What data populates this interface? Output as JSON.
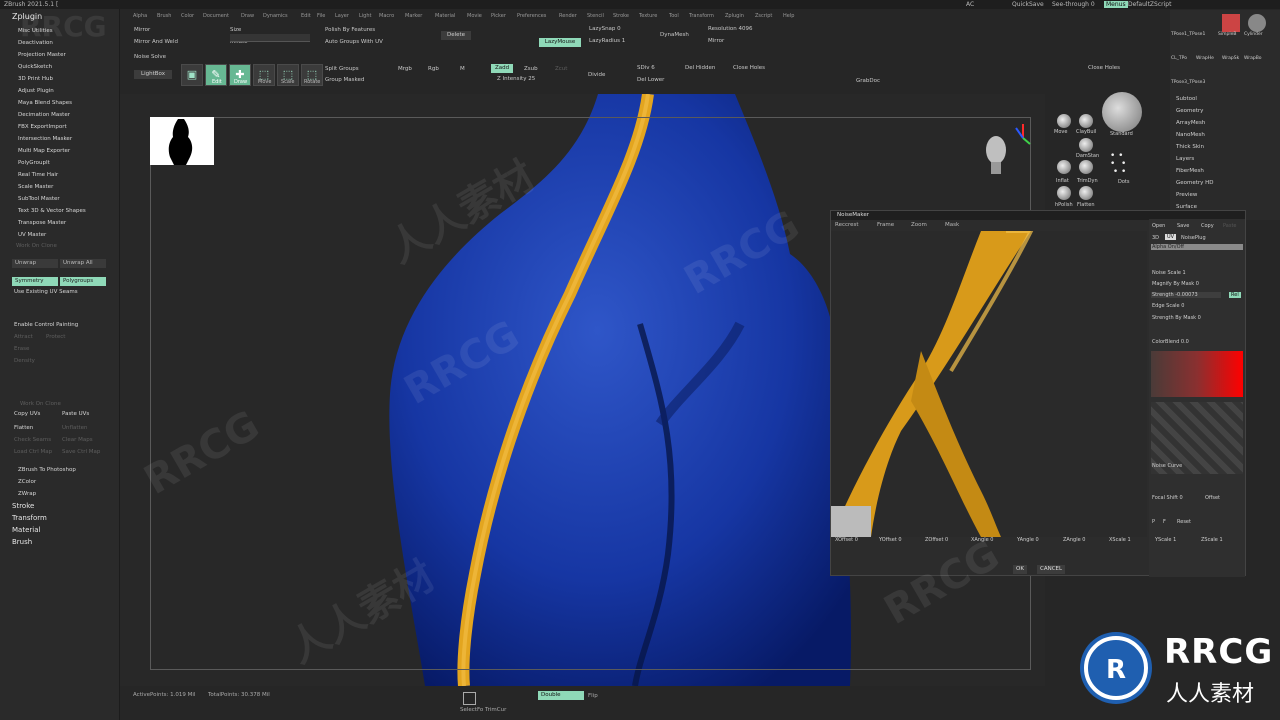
{
  "app": {
    "title": "ZBrush 2021.5.1 ["
  },
  "titlebar": {
    "ac": "AC",
    "quicksave": "QuickSave",
    "seethrough": "See-through 0",
    "menus": "Menus",
    "script": "DefaultZScript"
  },
  "menubar": [
    "Alpha",
    "Brush",
    "Color",
    "Document",
    "Draw",
    "Dynamics",
    "Edit",
    "File",
    "Layer",
    "Light",
    "Macro",
    "Marker",
    "Material",
    "Movie",
    "Picker",
    "Preferences",
    "Render",
    "Stencil",
    "Stroke",
    "Texture",
    "Tool",
    "Transform",
    "Zplugin",
    "Zscript",
    "Help"
  ],
  "left_panel": {
    "header": "Zplugin",
    "items": [
      "Misc Utilities",
      "Deactivation",
      "Projection Master",
      "QuickSketch",
      "3D Print Hub",
      "Adjust Plugin",
      "Maya Blend Shapes",
      "Decimation Master",
      "FBX ExportImport",
      "Intersection Masker",
      "Multi Map Exporter",
      "PolyGroupIt",
      "Real Time Hair",
      "Scale Master",
      "SubTool Master",
      "Text 3D & Vector Shapes",
      "Transpose Master",
      "UV Master"
    ],
    "uv": {
      "work_on_clone": "Work On Clone",
      "unwrap": "Unwrap",
      "unwrap_all": "Unwrap All",
      "symmetry": "Symmetry",
      "polygroups": "Polygroups",
      "use_existing": "Use Existing UV Seams",
      "enable_control": "Enable Control Painting",
      "copy_uvs": "Copy UVs",
      "paste_uvs": "Paste UVs",
      "flatten": "Flatten",
      "unflatten": "Unflatten",
      "check_seams": "Check Seams",
      "clear_maps": "Clear Maps",
      "load_ctrl": "Load Ctrl Map",
      "save_ctrl": "Save Ctrl Map",
      "attract": "Attract",
      "protect": "Protect",
      "erase": "Erase",
      "density": "Density",
      "work_clone2": "Work On Clone"
    },
    "extra": [
      "ZBrush To Photoshop",
      "ZColor",
      "ZWrap"
    ],
    "sections": [
      "Stroke",
      "Transform",
      "Material",
      "Brush"
    ]
  },
  "toolbar": {
    "mirror": "Mirror",
    "mirror_weld": "Mirror And Weld",
    "size": "Size",
    "inflate": "Inflate",
    "polish": "Polish By Features",
    "auto_groups": "Auto Groups With UV",
    "delete": "Delete",
    "lazysnap": "LazySnap 0",
    "lazymouse": "LazyMouse",
    "lazyradius": "LazyRadius 1",
    "dynamesh": "DynaMesh",
    "resolution": "Resolution 4096",
    "mirror2": "Mirror",
    "noise_solve": "Noise Solve",
    "lightbox": "LightBox",
    "edit": "Edit",
    "draw": "Draw",
    "move": "Move",
    "scale": "Scale",
    "rotate": "Rotate",
    "split_groups": "Split Groups",
    "group_masked": "Group Masked",
    "mrgb": "Mrgb",
    "rgb": "Rgb",
    "m": "M",
    "zadd": "Zadd",
    "zsub": "Zsub",
    "zcut": "Zcut",
    "z_intensity": "Z Intensity 25",
    "divide": "Divide",
    "sdiv": "SDiv 6",
    "del_lower": "Del Lower",
    "del_hidden": "Del Hidden",
    "close_holes": "Close Holes",
    "close_holes2": "Close Holes",
    "grabdoc": "GrabDoc"
  },
  "right_dock": [
    "Move",
    "ClayBuil",
    "Standard",
    "DamStan",
    "Inflat",
    "TrimDyn",
    "Dots",
    "hPolish",
    "Flatten"
  ],
  "right_panel": {
    "thumbs": [
      "TPose1_TPose1",
      "SimpleB",
      "Cylinder",
      "CL_TPo",
      "WrapHe",
      "WrapSk",
      "WrapBo",
      "TPose3_TPose3"
    ],
    "items": [
      "Subtool",
      "Geometry",
      "ArrayMesh",
      "NanoMesh",
      "Thick Skin",
      "Layers",
      "FiberMesh",
      "Geometry HD",
      "Preview",
      "Surface"
    ]
  },
  "noise_maker": {
    "title": "NoiseMaker",
    "tabs": [
      "Reccrest",
      "Frame",
      "Zoom",
      "Mask"
    ],
    "side": {
      "open": "Open",
      "save": "Save",
      "copy": "Copy",
      "paste": "Paste",
      "mode3d": "3D",
      "uv": "UV",
      "noiseplug": "NoisePlug",
      "alpha_on": "Alpha On/Off",
      "noise_scale": "Noise Scale 1",
      "magnify": "Magnify By Mask 0",
      "strength": "Strength -0.00073",
      "rel": "Rel",
      "edge_scale": "Edge Scale 0",
      "strength_mask": "Strength By Mask 0",
      "color_blend": "ColorBlend 0.0",
      "noise_curve": "Noise Curve",
      "focal": "Focal Shift 0",
      "offset": "Offset",
      "fn_p": "P",
      "fn_f": "F",
      "reset": "Reset"
    },
    "bottom": [
      "XOffset 0",
      "YOffset 0",
      "ZOffset 0",
      "XAngle 0",
      "YAngle 0",
      "ZAngle 0",
      "XScale 1",
      "YScale 1",
      "ZScale 1"
    ],
    "ok": "OK",
    "cancel": "CANCEL"
  },
  "status": {
    "active": "ActivePoints: 1.019 Mil",
    "total": "TotalPoints: 30.378 Mil",
    "double": "Double",
    "flip": "Flip",
    "selectlasso": "SelectFo TrimCur"
  },
  "watermark": {
    "rrcg": "RRCG",
    "cn": "人人素材"
  },
  "logo": {
    "name": "RRCG",
    "sub": "人人素材"
  }
}
